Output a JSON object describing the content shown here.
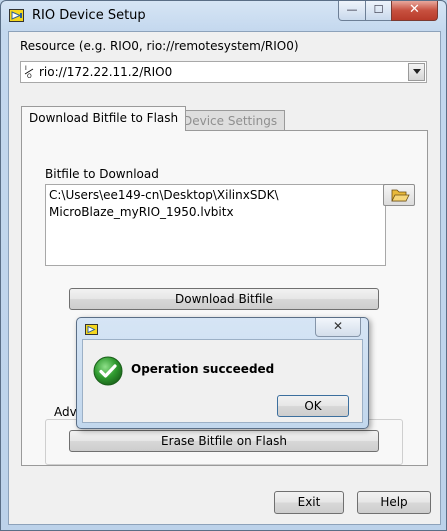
{
  "window": {
    "title": "RIO Device Setup",
    "controls": {
      "minimize": "—",
      "maximize": "☐",
      "close": "✕"
    }
  },
  "resource": {
    "label": "Resource (e.g. RIO0, rio://remotesystem/RIO0)",
    "io_icon": "I/O",
    "value": "rio://172.22.11.2/RIO0"
  },
  "tabs": [
    {
      "label": "Download Bitfile to Flash",
      "active": true
    },
    {
      "label": "Device Settings",
      "active": false
    }
  ],
  "download_tab": {
    "bitfile_label": "Bitfile to Download",
    "bitfile_path_line1": "C:\\Users\\ee149-cn\\Desktop\\XilinxSDK\\",
    "bitfile_path_line2": "MicroBlaze_myRIO_1950.lvbitx",
    "browse_icon": "folder-open-icon",
    "download_button": "Download Bitfile",
    "advanced_label": "Adv",
    "erase_button": "Erase Bitfile on Flash"
  },
  "footer": {
    "exit_button": "Exit",
    "help_button": "Help"
  },
  "dialog": {
    "close": "✕",
    "message": "Operation succeeded",
    "ok_button": "OK",
    "icon": "success-check-icon"
  },
  "colors": {
    "accent_green": "#2f9a2f",
    "labview_yellow": "#f4d61e",
    "title_bar": "#c4d8ee"
  }
}
